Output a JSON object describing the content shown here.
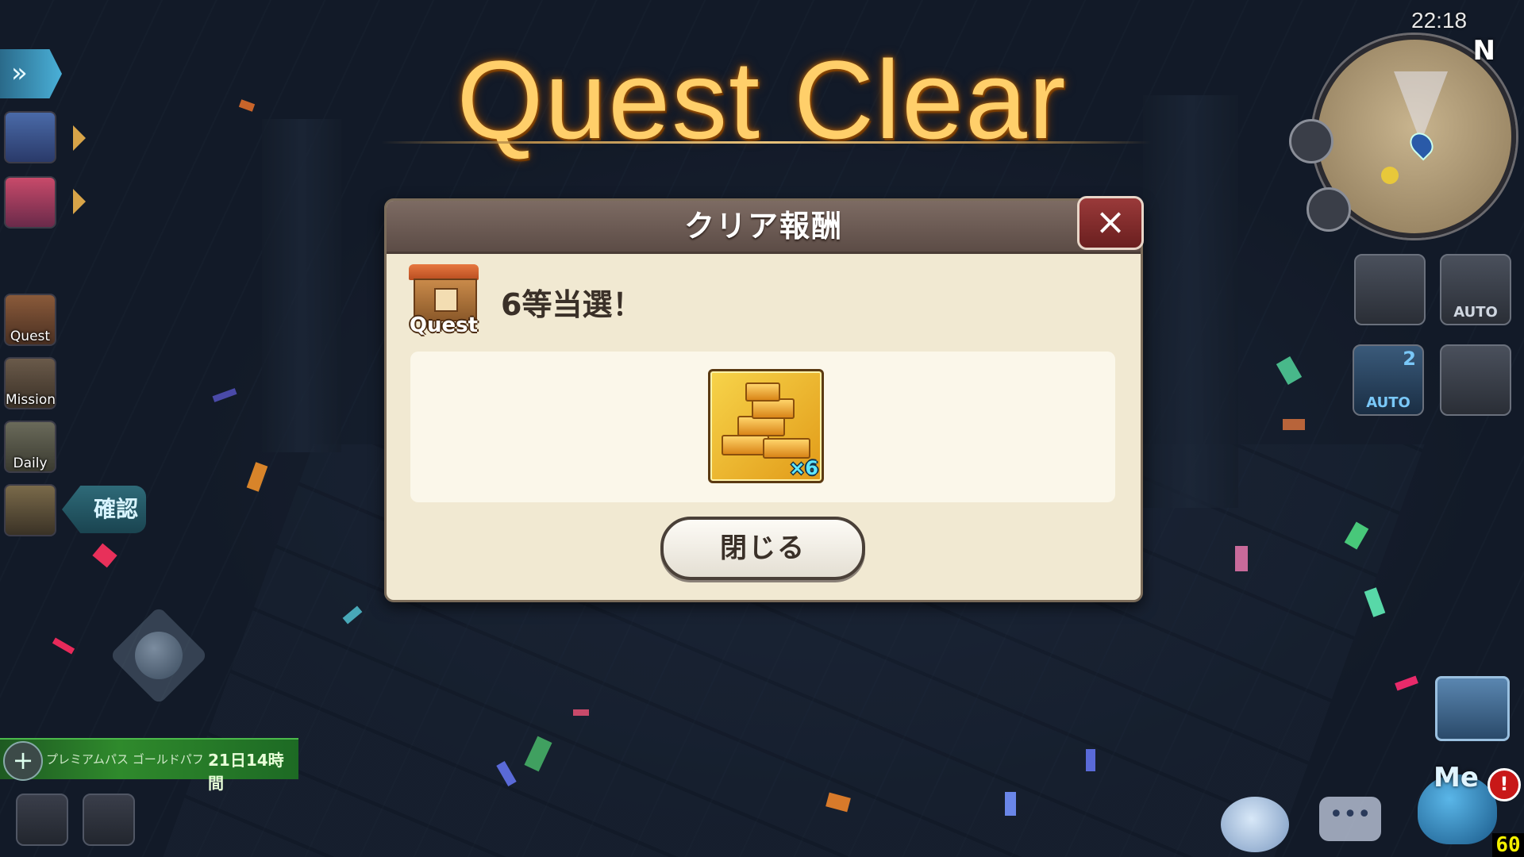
{
  "title": "Quest Clear",
  "dialog": {
    "header": "クリア報酬",
    "close_icon": "×",
    "quest_badge_label": "Quest",
    "win_text": "6等当選！",
    "reward": {
      "icon": "gold-bars-icon",
      "quantity": "×6"
    },
    "close_button_label": "閉じる"
  },
  "left_menu": {
    "quest_label": "Quest",
    "mission_label": "Mission",
    "daily_label": "Daily",
    "confirm_label": "確認"
  },
  "premium": {
    "name": "プレミアムパス ゴールドパフ",
    "time_left": "21日14時間"
  },
  "hud": {
    "clock": "22:18",
    "north": "N",
    "auto_label": "AUTO",
    "auto_skill_label": "AUTO",
    "auto_skill_number": "2",
    "me_label": "Me",
    "alert": "!",
    "chat_icon": "•••",
    "fps": "60"
  },
  "colors": {
    "title_gold": "#ffcf6a",
    "dialog_bg": "#f1e9d2",
    "header_bg": "#6d5c55",
    "close_red": "#8a2e2e",
    "qty_cyan": "#5fe7ff",
    "premium_green": "#2f8a2c"
  }
}
